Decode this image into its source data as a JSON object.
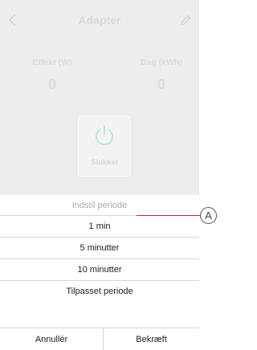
{
  "header": {
    "title": "Adapter",
    "back_icon": "chevron-left-icon",
    "edit_icon": "pencil-icon"
  },
  "metrics": [
    {
      "label": "Effekt (W)",
      "value": "0"
    },
    {
      "label": "Dag (kWh)",
      "value": "0"
    }
  ],
  "power": {
    "icon": "power-icon",
    "status": "Slukket",
    "accent_color": "#5ec9b3"
  },
  "sheet": {
    "title": "Indstil periode",
    "options": [
      "1 min",
      "5 minutter",
      "10 minutter",
      "Tilpasset periode"
    ],
    "cancel_label": "Annullér",
    "confirm_label": "Bekræft"
  },
  "callout": {
    "label": "A",
    "color": "#b32a5b"
  }
}
